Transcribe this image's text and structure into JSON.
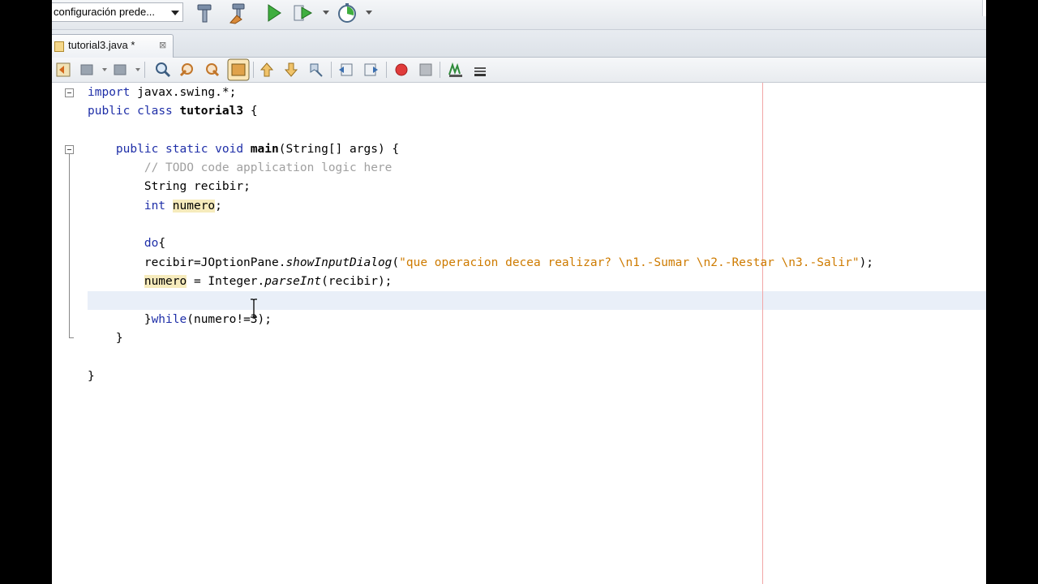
{
  "toolbar": {
    "config_label": "configuración prede..."
  },
  "tab": {
    "label": "tutorial3.java *",
    "close_glyph": "⊠"
  },
  "editor": {
    "line1": {
      "kw": "import",
      "rest": " javax.swing.*;"
    },
    "line2": {
      "kw1": "public",
      "kw2": "class",
      "name": "tutorial3",
      "rest": " {"
    },
    "line3": {
      "kw1": "public",
      "kw2": "static",
      "kw3": "void",
      "method": "main",
      "rest": "(String[] args) {"
    },
    "comment": "// TODO code application logic here",
    "line5": {
      "type": "String",
      "rest": " recibir;"
    },
    "line6": {
      "kw": "int",
      "var": "numero",
      "rest": ";"
    },
    "line7": {
      "kw": "do",
      "rest": "{"
    },
    "line8": {
      "a": "recibir=JOptionPane.",
      "method": "showInputDialog",
      "b": "(",
      "str": "\"que operacion decea realizar? \\n1.-Sumar \\n2.-Restar \\n3.-Salir\"",
      "c": ");"
    },
    "line9": {
      "var": "numero",
      "a": " = Integer.",
      "method": "parseInt",
      "b": "(recibir);"
    },
    "line11": {
      "a": "}",
      "kw": "while",
      "b": "(numero!=3);"
    },
    "line12": "}",
    "line14": "}"
  },
  "colors": {
    "keyword": "#1f2fa8",
    "comment": "#a0a0a0",
    "string": "#ce7b00",
    "highlight": "#f6ebbc",
    "margin": "#f2a6a6"
  }
}
